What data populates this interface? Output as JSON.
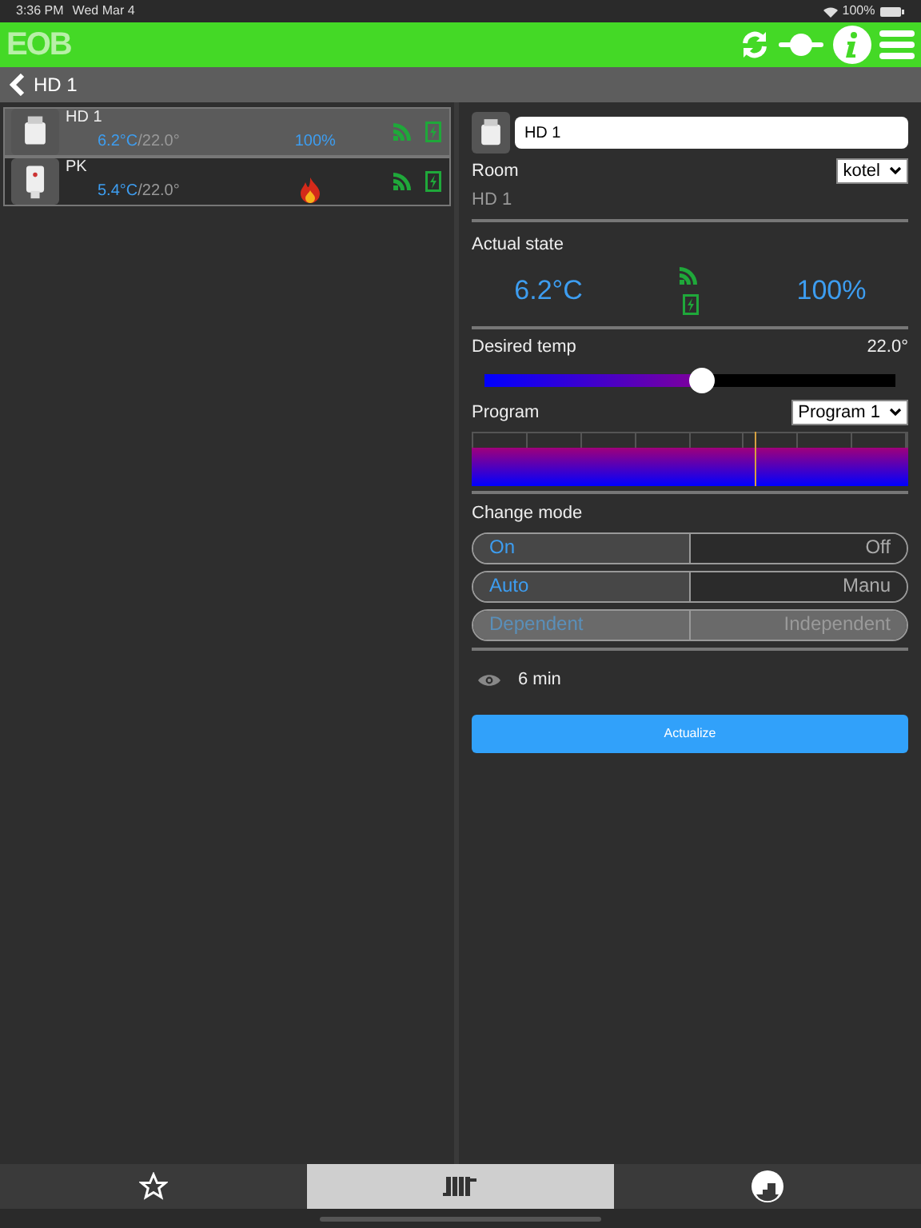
{
  "status_bar": {
    "time": "3:36 PM",
    "date": "Wed Mar 4",
    "battery": "100%"
  },
  "header": {
    "logo": "EOB"
  },
  "nav": {
    "title": "HD 1"
  },
  "devices": [
    {
      "kind": "head",
      "name": "HD 1",
      "temp": "6.2°C",
      "setpoint": "/22.0°",
      "valve": "100%",
      "selected": true,
      "heating": false
    },
    {
      "kind": "plug",
      "name": "PK",
      "temp": "5.4°C",
      "setpoint": "/22.0°",
      "selected": false,
      "heating": true
    }
  ],
  "detail": {
    "name": "HD 1",
    "room_label": "Room",
    "room": "kotel",
    "room_value": "HD 1",
    "actual_label": "Actual state",
    "actual_temp": "6.2°C",
    "actual_valve": "100%",
    "desired_label": "Desired temp",
    "desired_value": "22.0°",
    "desired_slider": {
      "level": 0.53
    },
    "program_label": "Program",
    "program": "Program 1",
    "program_now": {
      "level": 0.65
    },
    "mode_label": "Change mode",
    "modes": [
      {
        "disabled": false,
        "options": [
          {
            "label": "On",
            "selected": true
          },
          {
            "label": "Off",
            "selected": false
          }
        ]
      },
      {
        "disabled": false,
        "options": [
          {
            "label": "Auto",
            "selected": true
          },
          {
            "label": "Manu",
            "selected": false
          }
        ]
      },
      {
        "disabled": true,
        "options": [
          {
            "label": "Dependent",
            "selected": true
          },
          {
            "label": "Independent",
            "selected": false
          }
        ]
      }
    ],
    "interval": "6 min",
    "button": "Actualize"
  },
  "tabbar": [
    {
      "kind": "favorites",
      "selected": false
    },
    {
      "kind": "radiator",
      "selected": true
    },
    {
      "kind": "gauge",
      "selected": false
    }
  ]
}
